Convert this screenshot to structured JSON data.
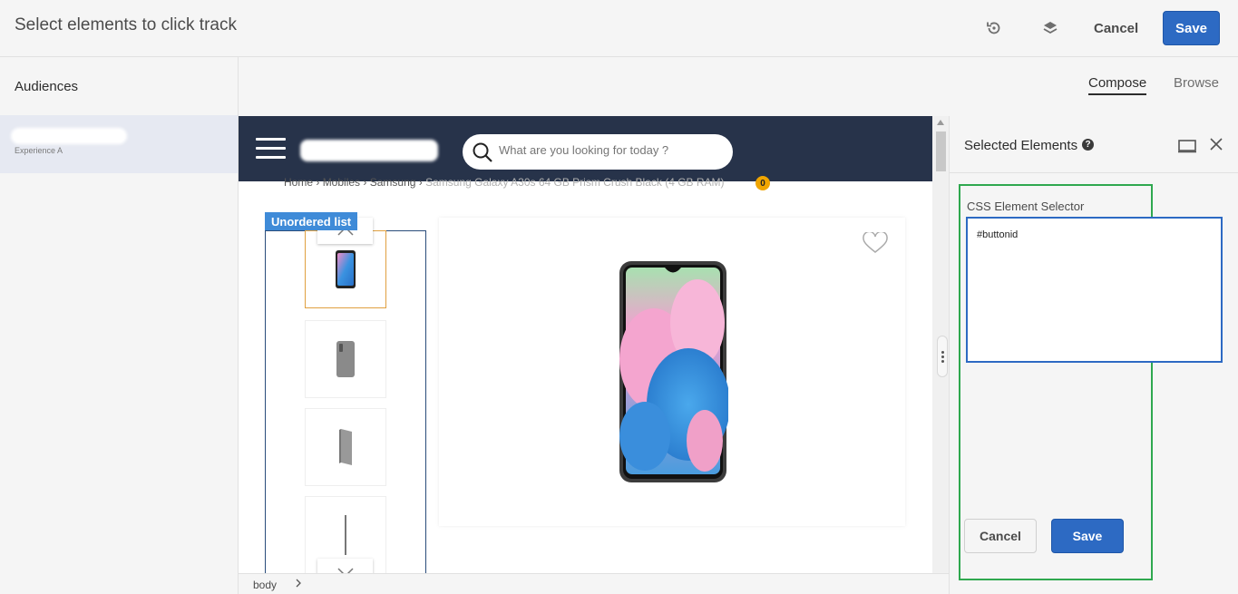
{
  "header": {
    "title": "Select elements to click track",
    "cancel_label": "Cancel",
    "save_label": "Save",
    "icons": [
      "history-icon",
      "layers-icon"
    ]
  },
  "sidebar": {
    "heading": "Audiences",
    "experience": {
      "subtitle": "Experience A"
    }
  },
  "mode_tabs": [
    {
      "label": "Compose",
      "active": true
    },
    {
      "label": "Browse",
      "active": false
    }
  ],
  "preview": {
    "search_placeholder": "What are you looking for today ?",
    "breadcrumb": {
      "items": [
        "Home",
        "Mobiles",
        "Samsung"
      ],
      "current": "Samsung Galaxy A30s 64 GB Prism Crush Black (4 GB RAM)"
    },
    "cart_count": "0",
    "selection_tag": "Unordered list"
  },
  "status_bar": {
    "element": "body"
  },
  "panel": {
    "title": "Selected Elements",
    "help": "?",
    "field_label": "CSS Element Selector",
    "selector_value": "#buttonid",
    "cancel_label": "Cancel",
    "save_label": "Save"
  },
  "colors": {
    "primary": "#2d6ac3",
    "site_header": "#27334a",
    "selection_tag": "#3f8bd8",
    "highlight": "#2fa84f",
    "badge": "#f0a500"
  }
}
